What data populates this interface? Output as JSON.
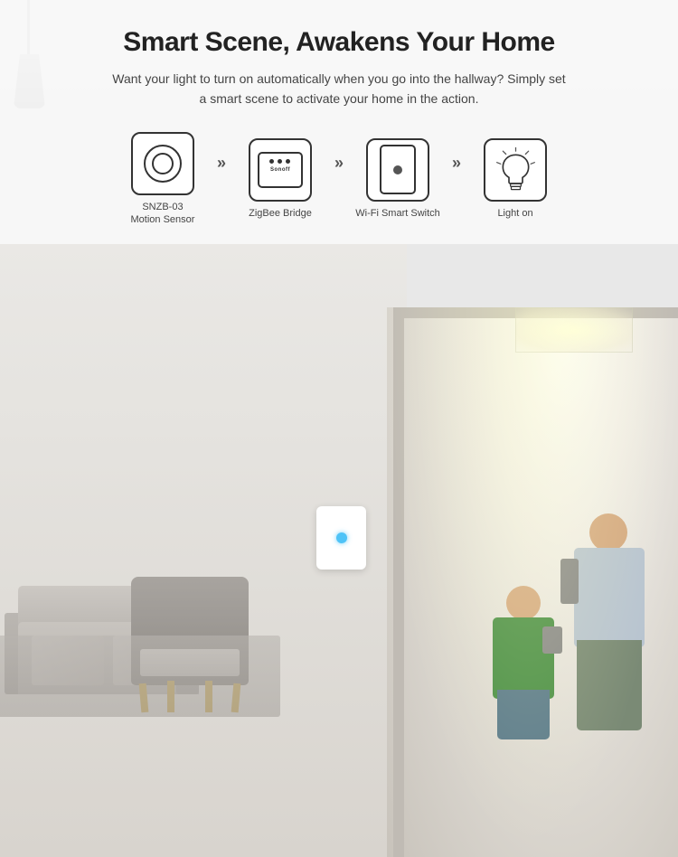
{
  "page": {
    "title": "Smart Scene, Awakens Your Home",
    "subtitle_line1": "Want your light to turn on automatically when you go into the hallway? Simply set",
    "subtitle_line2": "a smart scene to activate your home in the action.",
    "icons": [
      {
        "id": "motion-sensor",
        "label_line1": "SNZB-03",
        "label_line2": "Motion Sensor"
      },
      {
        "id": "zigbee-bridge",
        "label_line1": "ZigBee Bridge",
        "label_line2": ""
      },
      {
        "id": "wifi-switch",
        "label_line1": "Wi-Fi Smart Switch",
        "label_line2": ""
      },
      {
        "id": "light-on",
        "label_line1": "Light on",
        "label_line2": ""
      }
    ],
    "arrows": [
      "»",
      "»",
      "»"
    ]
  }
}
